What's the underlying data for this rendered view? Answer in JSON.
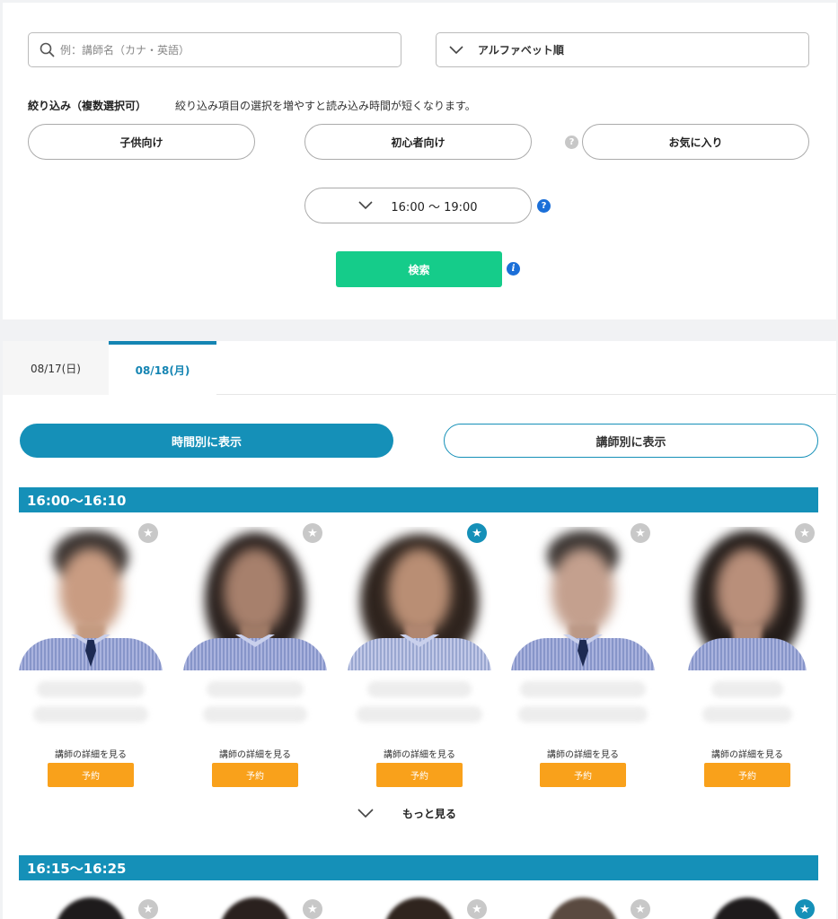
{
  "search": {
    "placeholder": "例：講師名（カナ・英語）",
    "sort_label": "アルファベット順"
  },
  "filters": {
    "title": "絞り込み（複数選択可）",
    "note": "絞り込み項目の選択を増やすと読み込み時間が短くなります。",
    "options": [
      {
        "label": "子供向け"
      },
      {
        "label": "初心者向け"
      },
      {
        "label": "お気に入り"
      }
    ],
    "time_range": "16:00 ～ 19:00",
    "search_button": "検索"
  },
  "tabs": [
    {
      "label": "08/17(日)",
      "active": false
    },
    {
      "label": "08/18(月)",
      "active": true
    }
  ],
  "view_toggle": {
    "by_time": "時間別に表示",
    "by_teacher": "講師別に表示"
  },
  "slots": [
    {
      "time": "16:00〜16:10",
      "teachers": [
        {
          "favorite": false,
          "detail_link": "講師の詳細を見る",
          "reserve": "予約"
        },
        {
          "favorite": false,
          "detail_link": "講師の詳細を見る",
          "reserve": "予約"
        },
        {
          "favorite": true,
          "detail_link": "講師の詳細を見る",
          "reserve": "予約"
        },
        {
          "favorite": false,
          "detail_link": "講師の詳細を見る",
          "reserve": "予約"
        },
        {
          "favorite": false,
          "detail_link": "講師の詳細を見る",
          "reserve": "予約"
        }
      ],
      "more_label": "もっと見る"
    },
    {
      "time": "16:15〜16:25",
      "teachers": [
        {
          "favorite": false
        },
        {
          "favorite": false
        },
        {
          "favorite": false
        },
        {
          "favorite": false
        },
        {
          "favorite": true
        }
      ]
    }
  ],
  "colors": {
    "accent": "#1590b8",
    "search_button": "#15cc8a",
    "reserve_button": "#f9a11b",
    "help_blue": "#1b6fd8"
  },
  "icons": [
    "search-icon",
    "chevron-down-icon",
    "help-icon",
    "info-icon",
    "star-icon"
  ]
}
